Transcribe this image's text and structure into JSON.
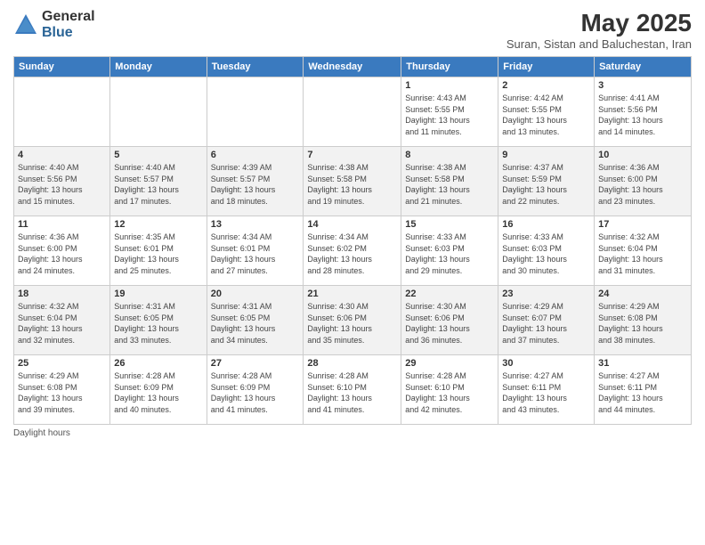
{
  "header": {
    "logo_general": "General",
    "logo_blue": "Blue",
    "month_title": "May 2025",
    "subtitle": "Suran, Sistan and Baluchestan, Iran"
  },
  "days_of_week": [
    "Sunday",
    "Monday",
    "Tuesday",
    "Wednesday",
    "Thursday",
    "Friday",
    "Saturday"
  ],
  "weeks": [
    [
      {
        "day": "",
        "info": ""
      },
      {
        "day": "",
        "info": ""
      },
      {
        "day": "",
        "info": ""
      },
      {
        "day": "",
        "info": ""
      },
      {
        "day": "1",
        "info": "Sunrise: 4:43 AM\nSunset: 5:55 PM\nDaylight: 13 hours\nand 11 minutes."
      },
      {
        "day": "2",
        "info": "Sunrise: 4:42 AM\nSunset: 5:55 PM\nDaylight: 13 hours\nand 13 minutes."
      },
      {
        "day": "3",
        "info": "Sunrise: 4:41 AM\nSunset: 5:56 PM\nDaylight: 13 hours\nand 14 minutes."
      }
    ],
    [
      {
        "day": "4",
        "info": "Sunrise: 4:40 AM\nSunset: 5:56 PM\nDaylight: 13 hours\nand 15 minutes."
      },
      {
        "day": "5",
        "info": "Sunrise: 4:40 AM\nSunset: 5:57 PM\nDaylight: 13 hours\nand 17 minutes."
      },
      {
        "day": "6",
        "info": "Sunrise: 4:39 AM\nSunset: 5:57 PM\nDaylight: 13 hours\nand 18 minutes."
      },
      {
        "day": "7",
        "info": "Sunrise: 4:38 AM\nSunset: 5:58 PM\nDaylight: 13 hours\nand 19 minutes."
      },
      {
        "day": "8",
        "info": "Sunrise: 4:38 AM\nSunset: 5:58 PM\nDaylight: 13 hours\nand 21 minutes."
      },
      {
        "day": "9",
        "info": "Sunrise: 4:37 AM\nSunset: 5:59 PM\nDaylight: 13 hours\nand 22 minutes."
      },
      {
        "day": "10",
        "info": "Sunrise: 4:36 AM\nSunset: 6:00 PM\nDaylight: 13 hours\nand 23 minutes."
      }
    ],
    [
      {
        "day": "11",
        "info": "Sunrise: 4:36 AM\nSunset: 6:00 PM\nDaylight: 13 hours\nand 24 minutes."
      },
      {
        "day": "12",
        "info": "Sunrise: 4:35 AM\nSunset: 6:01 PM\nDaylight: 13 hours\nand 25 minutes."
      },
      {
        "day": "13",
        "info": "Sunrise: 4:34 AM\nSunset: 6:01 PM\nDaylight: 13 hours\nand 27 minutes."
      },
      {
        "day": "14",
        "info": "Sunrise: 4:34 AM\nSunset: 6:02 PM\nDaylight: 13 hours\nand 28 minutes."
      },
      {
        "day": "15",
        "info": "Sunrise: 4:33 AM\nSunset: 6:03 PM\nDaylight: 13 hours\nand 29 minutes."
      },
      {
        "day": "16",
        "info": "Sunrise: 4:33 AM\nSunset: 6:03 PM\nDaylight: 13 hours\nand 30 minutes."
      },
      {
        "day": "17",
        "info": "Sunrise: 4:32 AM\nSunset: 6:04 PM\nDaylight: 13 hours\nand 31 minutes."
      }
    ],
    [
      {
        "day": "18",
        "info": "Sunrise: 4:32 AM\nSunset: 6:04 PM\nDaylight: 13 hours\nand 32 minutes."
      },
      {
        "day": "19",
        "info": "Sunrise: 4:31 AM\nSunset: 6:05 PM\nDaylight: 13 hours\nand 33 minutes."
      },
      {
        "day": "20",
        "info": "Sunrise: 4:31 AM\nSunset: 6:05 PM\nDaylight: 13 hours\nand 34 minutes."
      },
      {
        "day": "21",
        "info": "Sunrise: 4:30 AM\nSunset: 6:06 PM\nDaylight: 13 hours\nand 35 minutes."
      },
      {
        "day": "22",
        "info": "Sunrise: 4:30 AM\nSunset: 6:06 PM\nDaylight: 13 hours\nand 36 minutes."
      },
      {
        "day": "23",
        "info": "Sunrise: 4:29 AM\nSunset: 6:07 PM\nDaylight: 13 hours\nand 37 minutes."
      },
      {
        "day": "24",
        "info": "Sunrise: 4:29 AM\nSunset: 6:08 PM\nDaylight: 13 hours\nand 38 minutes."
      }
    ],
    [
      {
        "day": "25",
        "info": "Sunrise: 4:29 AM\nSunset: 6:08 PM\nDaylight: 13 hours\nand 39 minutes."
      },
      {
        "day": "26",
        "info": "Sunrise: 4:28 AM\nSunset: 6:09 PM\nDaylight: 13 hours\nand 40 minutes."
      },
      {
        "day": "27",
        "info": "Sunrise: 4:28 AM\nSunset: 6:09 PM\nDaylight: 13 hours\nand 41 minutes."
      },
      {
        "day": "28",
        "info": "Sunrise: 4:28 AM\nSunset: 6:10 PM\nDaylight: 13 hours\nand 41 minutes."
      },
      {
        "day": "29",
        "info": "Sunrise: 4:28 AM\nSunset: 6:10 PM\nDaylight: 13 hours\nand 42 minutes."
      },
      {
        "day": "30",
        "info": "Sunrise: 4:27 AM\nSunset: 6:11 PM\nDaylight: 13 hours\nand 43 minutes."
      },
      {
        "day": "31",
        "info": "Sunrise: 4:27 AM\nSunset: 6:11 PM\nDaylight: 13 hours\nand 44 minutes."
      }
    ]
  ],
  "footer": {
    "note": "Daylight hours"
  }
}
